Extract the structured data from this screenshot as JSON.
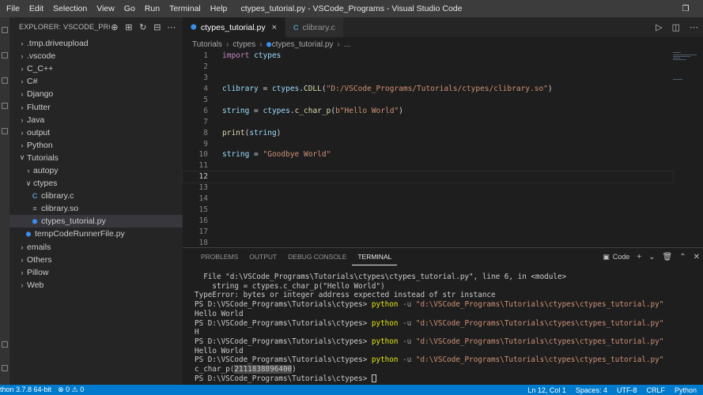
{
  "menu": [
    "File",
    "Edit",
    "Selection",
    "View",
    "Go",
    "Run",
    "Terminal",
    "Help"
  ],
  "window_title": "ctypes_tutorial.py - VSCode_Programs - Visual Studio Code",
  "explorer": {
    "title": "EXPLORER: VSCODE_PRO...",
    "items": [
      {
        "label": ".tmp.driveupload",
        "indent": 0,
        "kind": "folder-closed"
      },
      {
        "label": ".vscode",
        "indent": 0,
        "kind": "folder-closed"
      },
      {
        "label": "C_C++",
        "indent": 0,
        "kind": "folder-closed"
      },
      {
        "label": "C#",
        "indent": 0,
        "kind": "folder-closed"
      },
      {
        "label": "Django",
        "indent": 0,
        "kind": "folder-closed"
      },
      {
        "label": "Flutter",
        "indent": 0,
        "kind": "folder-closed"
      },
      {
        "label": "Java",
        "indent": 0,
        "kind": "folder-closed"
      },
      {
        "label": "output",
        "indent": 0,
        "kind": "folder-closed"
      },
      {
        "label": "Python",
        "indent": 0,
        "kind": "folder-closed"
      },
      {
        "label": "Tutorials",
        "indent": 0,
        "kind": "folder-open"
      },
      {
        "label": "autopy",
        "indent": 1,
        "kind": "folder-closed"
      },
      {
        "label": "ctypes",
        "indent": 1,
        "kind": "folder-open"
      },
      {
        "label": "clibrary.c",
        "indent": 2,
        "kind": "file-c"
      },
      {
        "label": "clibrary.so",
        "indent": 2,
        "kind": "file-so"
      },
      {
        "label": "ctypes_tutorial.py",
        "indent": 2,
        "kind": "file-py",
        "active": true
      },
      {
        "label": "tempCodeRunnerFile.py",
        "indent": 1,
        "kind": "file-py"
      },
      {
        "label": "emails",
        "indent": 0,
        "kind": "folder-closed"
      },
      {
        "label": "Others",
        "indent": 0,
        "kind": "folder-closed"
      },
      {
        "label": "Pillow",
        "indent": 0,
        "kind": "folder-closed"
      },
      {
        "label": "Web",
        "indent": 0,
        "kind": "folder-closed"
      }
    ]
  },
  "tabs": [
    {
      "label": "ctypes_tutorial.py",
      "icon": "py",
      "active": true
    },
    {
      "label": "clibrary.c",
      "icon": "C",
      "active": false
    }
  ],
  "breadcrumb": [
    "Tutorials",
    "ctypes",
    "ctypes_tutorial.py",
    "..."
  ],
  "code_lines": [
    [
      [
        "kw",
        "import"
      ],
      [
        "pl",
        " "
      ],
      [
        "vr",
        "ctypes"
      ]
    ],
    [],
    [],
    [
      [
        "vr",
        "clibrary"
      ],
      [
        "pl",
        " = "
      ],
      [
        "vr",
        "ctypes"
      ],
      [
        "pl",
        "."
      ],
      [
        "fn",
        "CDLL"
      ],
      [
        "pl",
        "("
      ],
      [
        "st",
        "\"D:/VSCode_Programs/Tutorials/ctypes/clibrary.so\""
      ],
      [
        "pl",
        ")"
      ]
    ],
    [],
    [
      [
        "vr",
        "string"
      ],
      [
        "pl",
        " = "
      ],
      [
        "vr",
        "ctypes"
      ],
      [
        "pl",
        "."
      ],
      [
        "fn",
        "c_char_p"
      ],
      [
        "pl",
        "("
      ],
      [
        "st",
        "b\"Hello World\""
      ],
      [
        "pl",
        ")"
      ]
    ],
    [],
    [
      [
        "fn",
        "print"
      ],
      [
        "pl",
        "("
      ],
      [
        "vr",
        "string"
      ],
      [
        "pl",
        ")"
      ]
    ],
    [],
    [
      [
        "vr",
        "string"
      ],
      [
        "pl",
        " = "
      ],
      [
        "st",
        "\"Goodbye World\""
      ]
    ],
    [],
    [],
    [],
    [],
    [],
    [],
    [],
    []
  ],
  "current_line": 12,
  "panel": {
    "tabs": [
      "PROBLEMS",
      "OUTPUT",
      "DEBUG CONSOLE",
      "TERMINAL"
    ],
    "active_tab": "TERMINAL",
    "shell_label": "Code"
  },
  "terminal_lines": [
    [
      [
        "t",
        "  File \"d:\\VSCode_Programs\\Tutorials\\ctypes\\ctypes_tutorial.py\", line 6, in <module>"
      ]
    ],
    [
      [
        "t",
        "    string = ctypes.c_char_p(\"Hello World\")"
      ]
    ],
    [
      [
        "t",
        "TypeError: bytes or integer address expected instead of str instance"
      ]
    ],
    [
      [
        "t",
        "PS D:\\VSCode_Programs\\Tutorials\\ctypes> "
      ],
      [
        "cmd",
        "python"
      ],
      [
        "opt",
        " -u "
      ],
      [
        "arg",
        "\"d:\\VSCode_Programs\\Tutorials\\ctypes\\ctypes_tutorial.py\""
      ]
    ],
    [
      [
        "t",
        "Hello World"
      ]
    ],
    [
      [
        "t",
        "PS D:\\VSCode_Programs\\Tutorials\\ctypes> "
      ],
      [
        "cmd",
        "python"
      ],
      [
        "opt",
        " -u "
      ],
      [
        "arg",
        "\"d:\\VSCode_Programs\\Tutorials\\ctypes\\ctypes_tutorial.py\""
      ]
    ],
    [
      [
        "t",
        "H"
      ]
    ],
    [
      [
        "t",
        "PS D:\\VSCode_Programs\\Tutorials\\ctypes> "
      ],
      [
        "cmd",
        "python"
      ],
      [
        "opt",
        " -u "
      ],
      [
        "arg",
        "\"d:\\VSCode_Programs\\Tutorials\\ctypes\\ctypes_tutorial.py\""
      ]
    ],
    [
      [
        "t",
        "Hello World"
      ]
    ],
    [
      [
        "t",
        "PS D:\\VSCode_Programs\\Tutorials\\ctypes> "
      ],
      [
        "cmd",
        "python"
      ],
      [
        "opt",
        " -u "
      ],
      [
        "arg",
        "\"d:\\VSCode_Programs\\Tutorials\\ctypes\\ctypes_tutorial.py\""
      ]
    ],
    [
      [
        "t",
        "c_char_p("
      ],
      [
        "hl",
        "2111838896400"
      ],
      [
        "t",
        ")"
      ]
    ],
    [
      [
        "t",
        "PS D:\\VSCode_Programs\\Tutorials\\ctypes> "
      ],
      [
        "cursor",
        ""
      ]
    ]
  ],
  "status": {
    "interpreter": "thon 3.7.8 64-bit",
    "errors": "0",
    "warnings": "0",
    "position": "Ln 12, Col 1",
    "spaces": "Spaces: 4",
    "encoding": "UTF-8",
    "eol": "CRLF",
    "language": "Python"
  },
  "colors": {
    "statusbar": "#007acc",
    "editor_bg": "#1e1e1e",
    "sidebar_bg": "#252526",
    "keyword": "#c586c0",
    "function": "#dcdcaa",
    "string": "#ce9178",
    "variable": "#9cdcfe",
    "terminal_command": "#e5e510"
  }
}
